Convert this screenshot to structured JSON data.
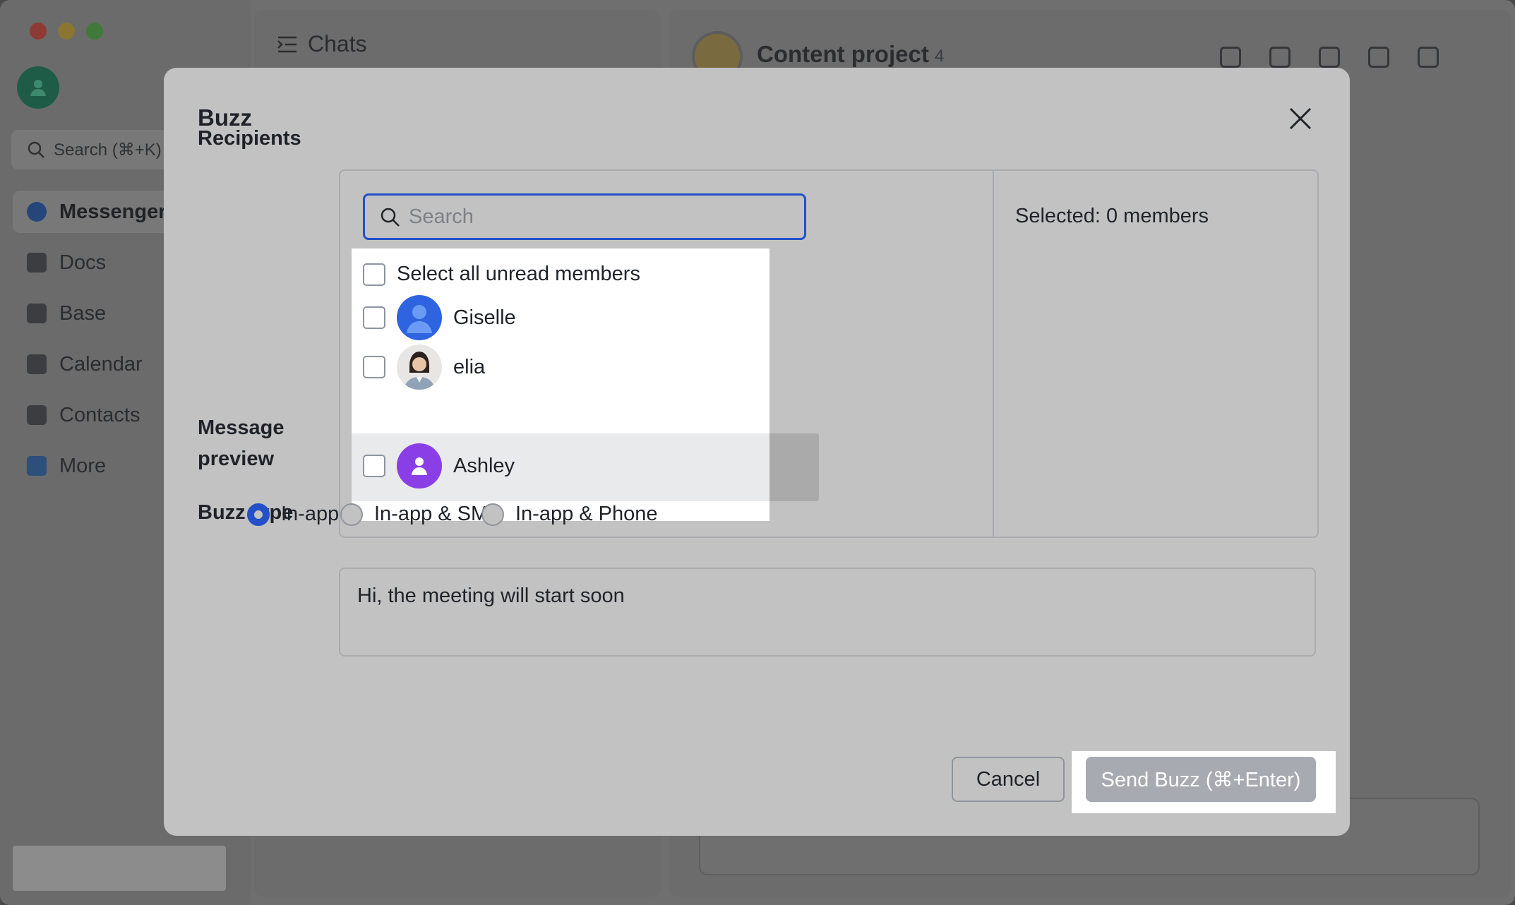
{
  "background": {
    "sidebar": {
      "search_placeholder": "Search (⌘+K)",
      "items": [
        {
          "label": "Messenger",
          "active": true
        },
        {
          "label": "Docs"
        },
        {
          "label": "Base"
        },
        {
          "label": "Calendar"
        },
        {
          "label": "Contacts"
        },
        {
          "label": "More"
        }
      ]
    },
    "chats": {
      "title": "Chats"
    },
    "conversation": {
      "title": "Content project",
      "member_count": "4"
    }
  },
  "modal": {
    "title": "Buzz",
    "close_icon": "close-icon",
    "recipients": {
      "label": "Recipients",
      "search_placeholder": "Search",
      "select_all_label": "Select all unread members",
      "members": [
        {
          "name": "Giselle"
        },
        {
          "name": "elia"
        },
        {
          "name": "Ashley"
        }
      ],
      "selected_text": "Selected: 0 members"
    },
    "message_preview": {
      "label_line1": "Message",
      "label_line2": "preview",
      "text": "Hi, the meeting will start soon"
    },
    "buzz_type": {
      "label": "Buzz type",
      "options": [
        {
          "label": "In-app",
          "selected": true
        },
        {
          "label": "In-app & SMS",
          "selected": false
        },
        {
          "label": "In-app & Phone",
          "selected": false
        }
      ]
    },
    "buttons": {
      "cancel": "Cancel",
      "send": "Send Buzz (⌘+Enter)"
    }
  },
  "colors": {
    "accent": "#2350c8",
    "send_disabled": "#a7abb1",
    "avatar_giselle": "#2f64e0",
    "avatar_ashley": "#8a3fe6"
  }
}
